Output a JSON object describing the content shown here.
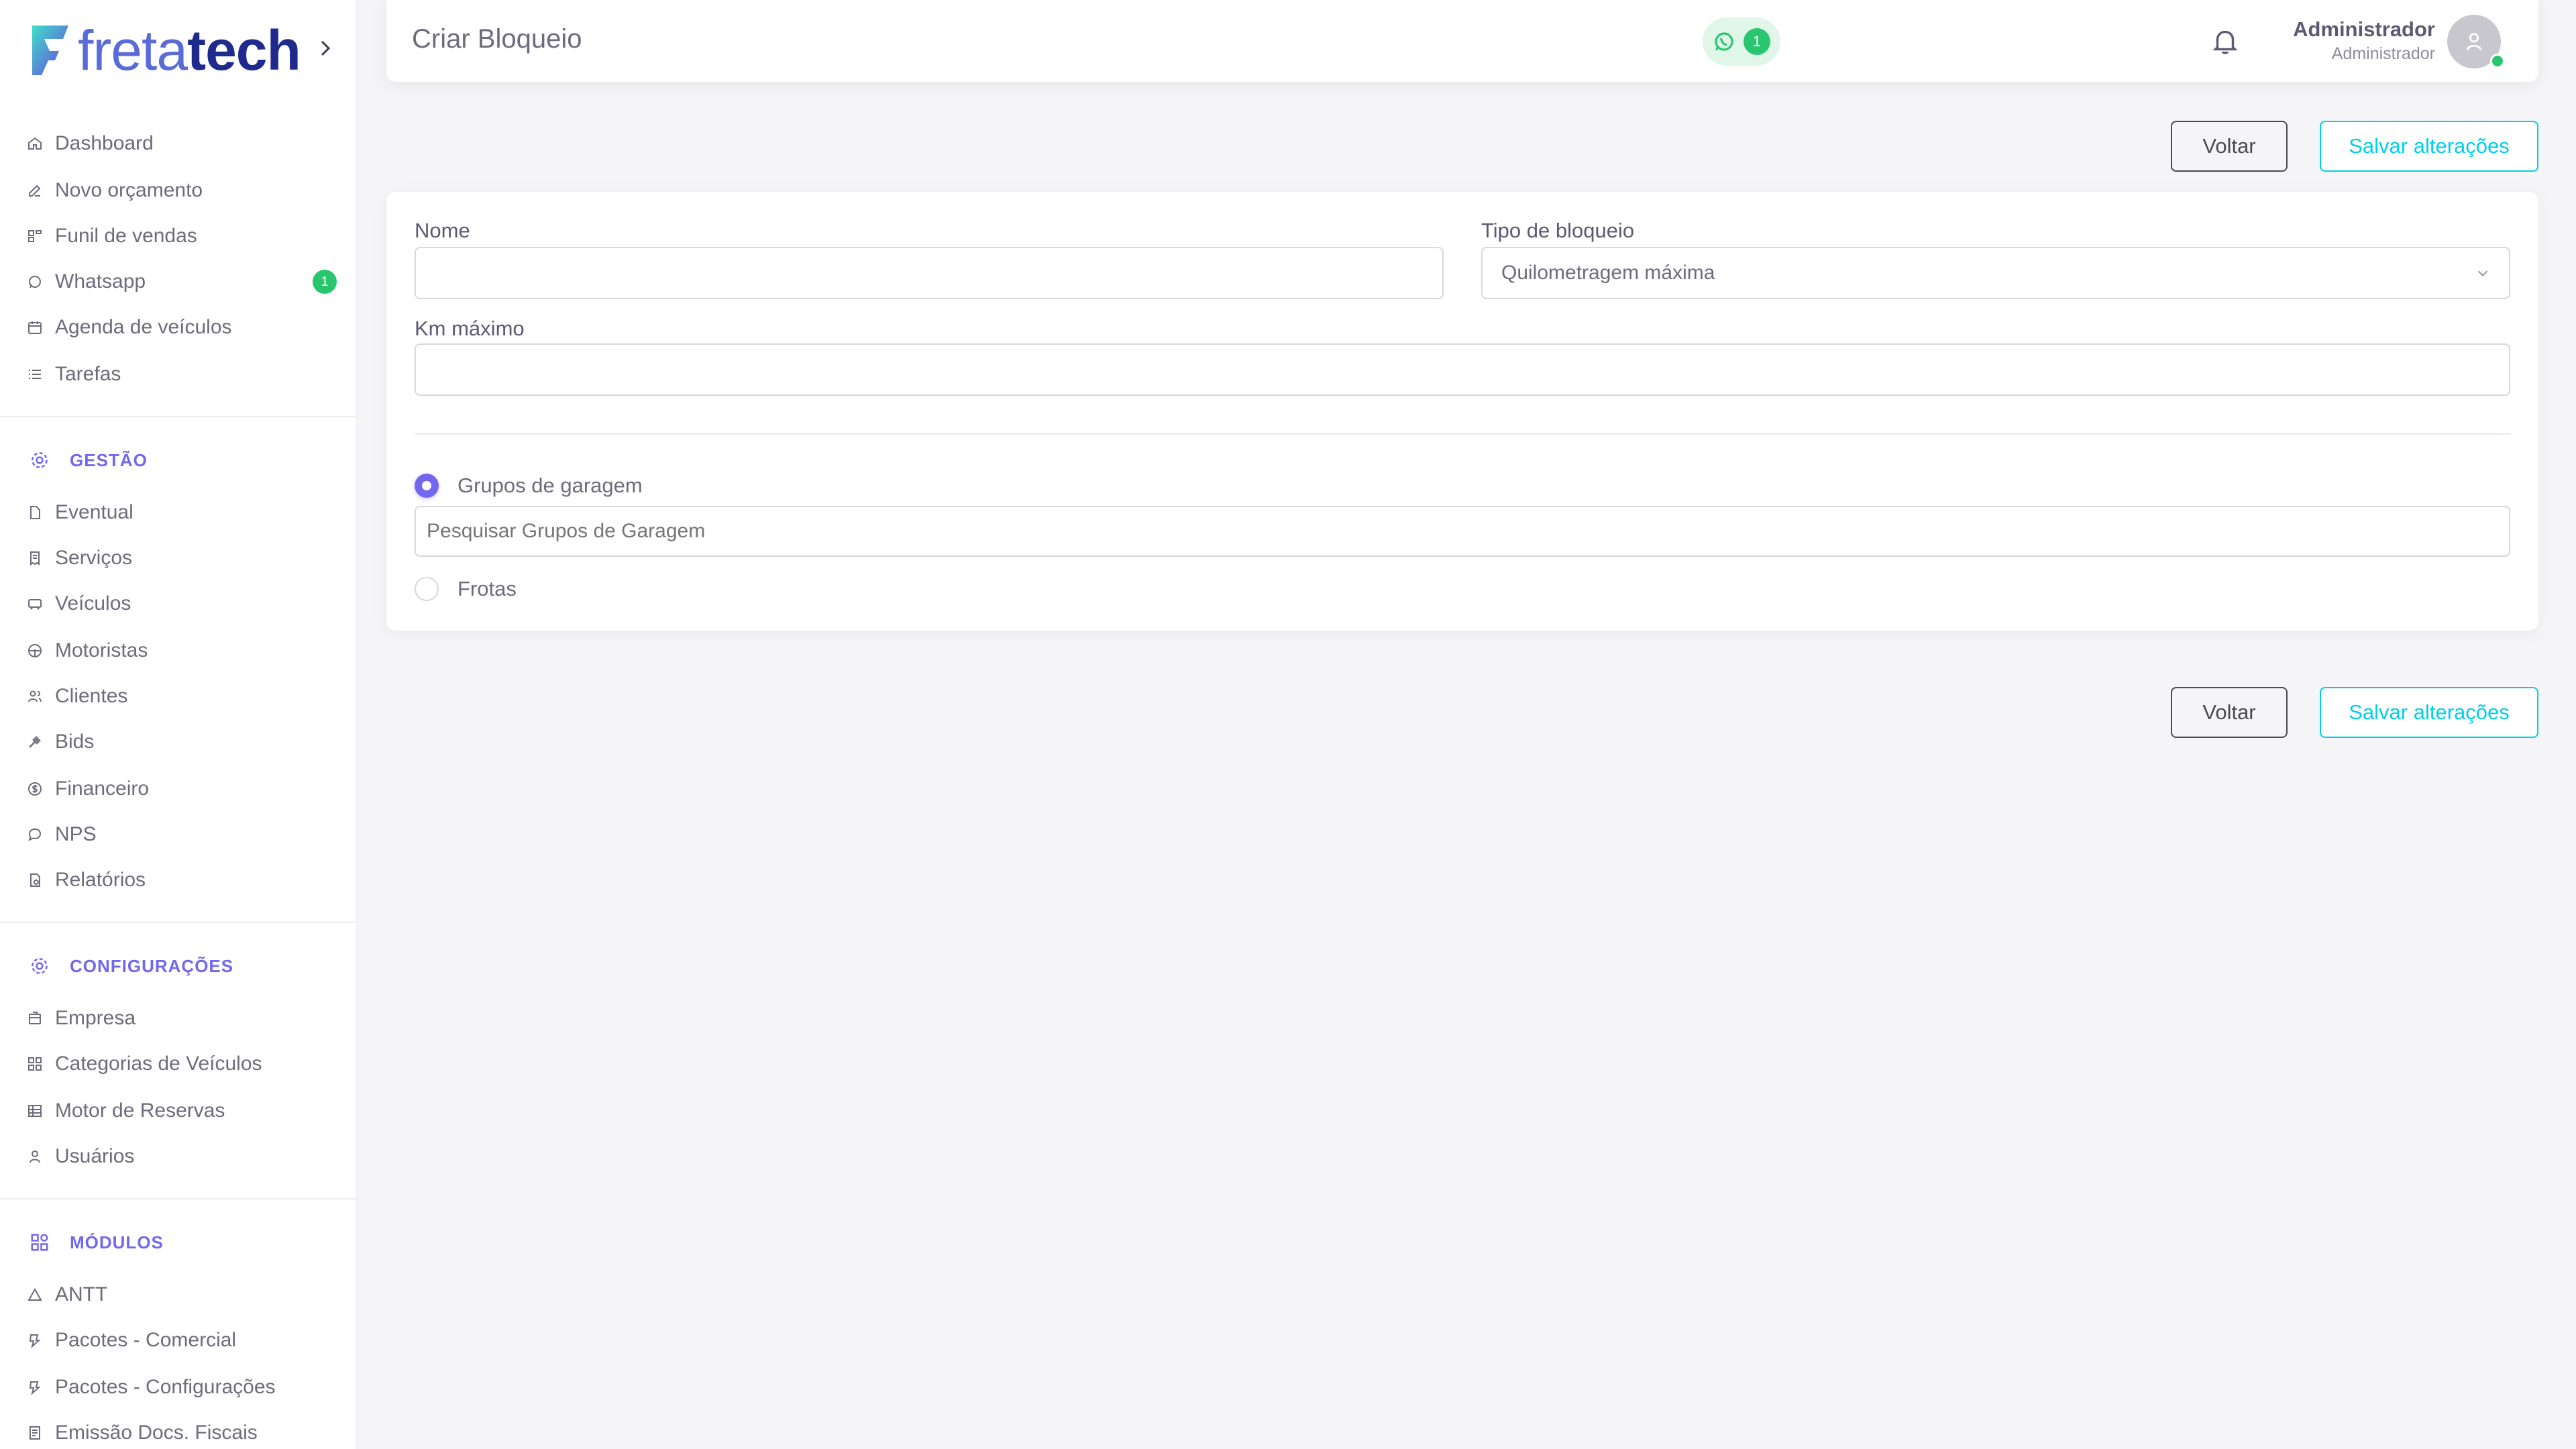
{
  "brand": {
    "name_light": "freta",
    "name_bold": "tech"
  },
  "sidebar": {
    "main_items": [
      {
        "label": "Dashboard",
        "icon": "home-icon"
      },
      {
        "label": "Novo orçamento",
        "icon": "edit-icon"
      },
      {
        "label": "Funil de vendas",
        "icon": "funnel-icon"
      },
      {
        "label": "Whatsapp",
        "icon": "whatsapp-icon",
        "badge": "1"
      },
      {
        "label": "Agenda de veículos",
        "icon": "calendar-icon"
      },
      {
        "label": "Tarefas",
        "icon": "list-icon"
      }
    ],
    "gestao": {
      "title": "GESTÃO",
      "items": [
        {
          "label": "Eventual",
          "icon": "file-icon"
        },
        {
          "label": "Serviços",
          "icon": "receipt-icon"
        },
        {
          "label": "Veículos",
          "icon": "bus-icon"
        },
        {
          "label": "Motoristas",
          "icon": "steering-wheel-icon"
        },
        {
          "label": "Clientes",
          "icon": "users-icon"
        },
        {
          "label": "Bids",
          "icon": "gavel-icon"
        },
        {
          "label": "Financeiro",
          "icon": "dollar-icon"
        },
        {
          "label": "NPS",
          "icon": "chat-icon"
        },
        {
          "label": "Relatórios",
          "icon": "report-icon"
        }
      ]
    },
    "configuracoes": {
      "title": "CONFIGURAÇÕES",
      "items": [
        {
          "label": "Empresa",
          "icon": "building-icon"
        },
        {
          "label": "Categorias de Veículos",
          "icon": "grid-icon"
        },
        {
          "label": "Motor de Reservas",
          "icon": "table-icon"
        },
        {
          "label": "Usuários",
          "icon": "user-icon"
        }
      ]
    },
    "modulos": {
      "title": "MÓDULOS",
      "items": [
        {
          "label": "ANTT",
          "icon": "triangle-icon"
        },
        {
          "label": "Pacotes - Comercial",
          "icon": "package-icon"
        },
        {
          "label": "Pacotes - Configurações",
          "icon": "package-icon"
        },
        {
          "label": "Emissão Docs. Fiscais",
          "icon": "document-icon"
        }
      ]
    }
  },
  "header": {
    "title": "Criar Bloqueio",
    "whatsapp_count": "1",
    "user_name": "Administrador",
    "user_role": "Administrador"
  },
  "actions": {
    "back_label": "Voltar",
    "save_label": "Salvar alterações"
  },
  "form": {
    "nome_label": "Nome",
    "nome_value": "",
    "tipo_label": "Tipo de bloqueio",
    "tipo_value": "Quilometragem máxima",
    "km_label": "Km máximo",
    "km_value": "",
    "radio_groups_label": "Grupos de garagem",
    "radio_groups_selected": true,
    "search_groups_placeholder": "Pesquisar Grupos de Garagem",
    "radio_frotas_label": "Frotas",
    "radio_frotas_selected": false
  },
  "colors": {
    "accent": "#7367f0",
    "save": "#00cfe8",
    "success": "#28c76f"
  }
}
